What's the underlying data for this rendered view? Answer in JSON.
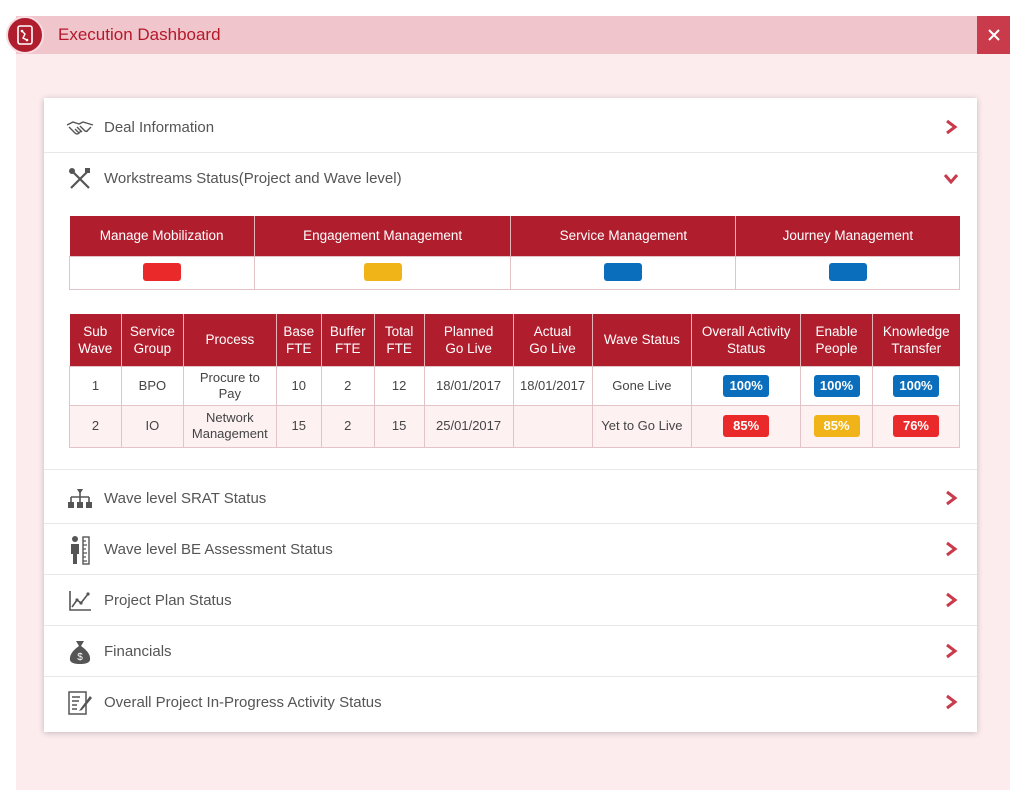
{
  "header": {
    "title": "Execution Dashboard"
  },
  "colors": {
    "blue": "#0a6ebd",
    "yellow": "#f0b419",
    "red": "#ea2a2a",
    "brand": "#b01e2e"
  },
  "sections": [
    {
      "label": "Deal Information",
      "icon": "handshake-icon",
      "state": "collapsed"
    },
    {
      "label": "Workstreams Status(Project and Wave level)",
      "icon": "tools-icon",
      "state": "expanded"
    },
    {
      "label": "Wave level SRAT Status",
      "icon": "hierarchy-icon",
      "state": "collapsed"
    },
    {
      "label": "Wave level BE Assessment Status",
      "icon": "person-ruler-icon",
      "state": "collapsed"
    },
    {
      "label": "Project Plan Status",
      "icon": "line-chart-icon",
      "state": "collapsed"
    },
    {
      "label": "Financials",
      "icon": "money-bag-icon",
      "state": "collapsed"
    },
    {
      "label": "Overall Project In-Progress Activity Status",
      "icon": "document-pen-icon",
      "state": "collapsed"
    }
  ],
  "workstreams": {
    "headers": [
      "Manage Mobilization",
      "Engagement Management",
      "Service Management",
      "Journey Management"
    ],
    "status_colors": [
      "red",
      "yellow",
      "blue",
      "blue"
    ]
  },
  "wave_table": {
    "headers": {
      "sub_wave": [
        "Sub",
        "Wave"
      ],
      "service_group": [
        "Service",
        "Group"
      ],
      "process": "Process",
      "base_fte": [
        "Base",
        "FTE"
      ],
      "buffer_fte": [
        "Buffer",
        "FTE"
      ],
      "total_fte": [
        "Total",
        "FTE"
      ],
      "planned_go_live": [
        "Planned",
        "Go Live"
      ],
      "actual_go_live": [
        "Actual",
        "Go Live"
      ],
      "wave_status": "Wave Status",
      "overall_activity_status": [
        "Overall Activity",
        "Status"
      ],
      "enable_people": [
        "Enable",
        "People"
      ],
      "knowledge_transfer": [
        "Knowledge",
        "Transfer"
      ]
    },
    "rows": [
      {
        "sub_wave": "1",
        "service_group": "BPO",
        "process": [
          "Procure to",
          "Pay"
        ],
        "base_fte": "10",
        "buffer_fte": "2",
        "total_fte": "12",
        "planned_go_live": "18/01/2017",
        "actual_go_live": "18/01/2017",
        "wave_status": "Gone Live",
        "overall_activity": {
          "value": "100%",
          "color": "blue"
        },
        "enable_people": {
          "value": "100%",
          "color": "blue"
        },
        "knowledge_transfer": {
          "value": "100%",
          "color": "blue"
        }
      },
      {
        "sub_wave": "2",
        "service_group": "IO",
        "process": [
          "Network",
          "Management"
        ],
        "base_fte": "15",
        "buffer_fte": "2",
        "total_fte": "15",
        "planned_go_live": "25/01/2017",
        "actual_go_live": "",
        "wave_status": "Yet to Go Live",
        "overall_activity": {
          "value": "85%",
          "color": "red"
        },
        "enable_people": {
          "value": "85%",
          "color": "yellow"
        },
        "knowledge_transfer": {
          "value": "76%",
          "color": "red"
        }
      }
    ]
  }
}
